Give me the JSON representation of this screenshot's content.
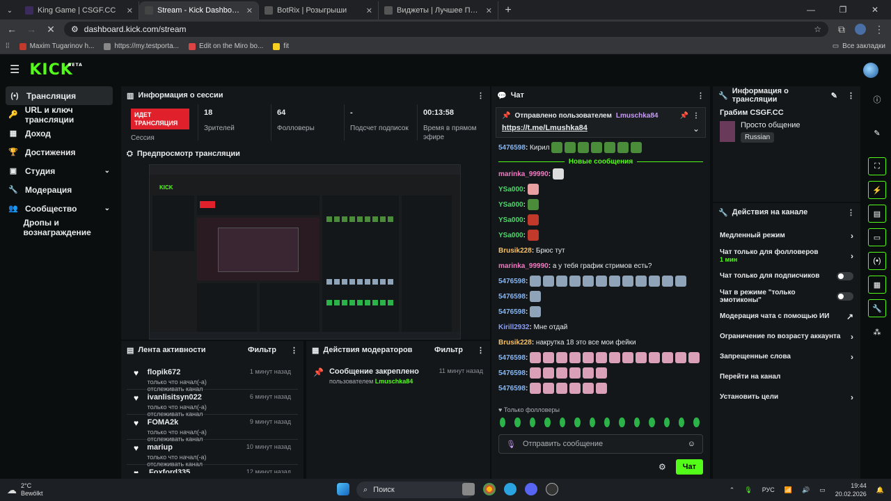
{
  "browser": {
    "tabs": [
      {
        "title": "King Game | CSGF.CC",
        "fav_color": "#3a2b5c"
      },
      {
        "title": "Stream - Kick Dashboard",
        "fav_color": "#444"
      },
      {
        "title": "BotRix | Розыгрыши",
        "fav_color": "#555"
      },
      {
        "title": "Виджеты | Лучшее ПО для улу",
        "fav_color": "#555"
      }
    ],
    "url": "dashboard.kick.com/stream",
    "bookmarks": [
      "Maxim Tugarinov h...",
      "https://my.testporta...",
      "Edit on the Miro bo...",
      "fit"
    ],
    "all_bookmarks": "Все закладки"
  },
  "app": {
    "logo": "KICK",
    "logo_badge": "BETA",
    "sidebar": [
      {
        "icon": "(•)",
        "label": "Трансляция",
        "active": true
      },
      {
        "icon": "🔑",
        "label": "URL и ключ трансляции"
      },
      {
        "icon": "▦",
        "label": "Доход"
      },
      {
        "icon": "🏆",
        "label": "Достижения"
      },
      {
        "icon": "▣",
        "label": "Студия",
        "chev": true
      },
      {
        "icon": "🔧",
        "label": "Модерация"
      },
      {
        "icon": "👥",
        "label": "Сообщество",
        "chev": true
      },
      {
        "icon": "",
        "label": "Дропы и вознаграждение"
      }
    ],
    "session": {
      "title": "Информация о сессии",
      "live_badge": "ИДЕТ ТРАНСЛЯЦИЯ",
      "cells": [
        {
          "value": "",
          "label": "Сессия"
        },
        {
          "value": "18",
          "label": "Зрителей"
        },
        {
          "value": "64",
          "label": "Фолловеры"
        },
        {
          "value": "-",
          "label": "Подсчет подписок"
        },
        {
          "value": "00:13:58",
          "label": "Время в прямом эфире"
        }
      ]
    },
    "preview": {
      "title": "Предпросмотр трансляции"
    },
    "feed": {
      "title": "Лента активности",
      "filter": "Фильтр",
      "items": [
        {
          "name": "flopik672",
          "sub": "только что начал(-а) отслеживать канал",
          "time": "1 минут назад"
        },
        {
          "name": "ivanlisitsyn022",
          "sub": "только что начал(-а) отслеживать канал",
          "time": "6 минут назад"
        },
        {
          "name": "FOMA2k",
          "sub": "только что начал(-а) отслеживать канал",
          "time": "9 минут назад"
        },
        {
          "name": "mariup",
          "sub": "только что начал(-а) отслеживать канал",
          "time": "10 минут назад"
        },
        {
          "name": "Foxford335",
          "sub": "",
          "time": "12 минут назад"
        }
      ]
    },
    "modactions": {
      "title": "Действия модераторов",
      "filter": "Фильтр",
      "item": {
        "title": "Сообщение закреплено",
        "sub_prefix": "пользователем",
        "user": "Lmuschka84",
        "time": "11 минут назад"
      }
    },
    "chat": {
      "title": "Чат",
      "pinned_by": "Отправлено пользователем",
      "pinned_user": "Lmuschka84",
      "pinned_link": "https://t.me/Lmushka84",
      "new_messages": "Новые сообщения",
      "messages": [
        {
          "user": "5476598",
          "color": "#86b8f7",
          "text": "Кирил",
          "emotes": 7,
          "emote_color": "#4a8c3a"
        },
        {
          "user": "marinka_99990",
          "color": "#f07ac2",
          "text": "",
          "emotes": 1,
          "emote_color": "#ddd"
        },
        {
          "user": "YSa000",
          "color": "#4cd96a",
          "text": "",
          "emotes": 1,
          "emote_color": "#e8a0a0"
        },
        {
          "user": "YSa000",
          "color": "#4cd96a",
          "text": "",
          "emotes": 1,
          "emote_color": "#4a8c3a"
        },
        {
          "user": "YSa000",
          "color": "#4cd96a",
          "text": "",
          "emotes": 1,
          "emote_color": "#c0392b"
        },
        {
          "user": "YSa000",
          "color": "#4cd96a",
          "text": "",
          "emotes": 1,
          "emote_color": "#c0392b"
        },
        {
          "user": "Brusik228",
          "color": "#f5c06a",
          "text": "Брюс тут",
          "emotes": 0
        },
        {
          "user": "marinka_99990",
          "color": "#f07ac2",
          "text": "а у тебя график стримов есть?",
          "emotes": 0
        },
        {
          "user": "5476598",
          "color": "#86b8f7",
          "text": "",
          "emotes": 12,
          "emote_color": "#8fa4b8"
        },
        {
          "user": "5476598",
          "color": "#86b8f7",
          "text": "",
          "emotes": 1,
          "emote_color": "#8fa4b8"
        },
        {
          "user": "5476598",
          "color": "#86b8f7",
          "text": "",
          "emotes": 1,
          "emote_color": "#8fa4b8"
        },
        {
          "user": "Kirill2932",
          "color": "#8a9ef7",
          "text": "Мне отдай",
          "emotes": 0
        },
        {
          "user": "Brusik228",
          "color": "#f5c06a",
          "text": "накрутка 18 это все мои фейки",
          "emotes": 0
        },
        {
          "user": "5476598",
          "color": "#86b8f7",
          "text": "",
          "emotes": 13,
          "emote_color": "#d9a0b8"
        },
        {
          "user": "5476598",
          "color": "#86b8f7",
          "text": "",
          "emotes": 6,
          "emote_color": "#d9a0b8"
        },
        {
          "user": "5476598",
          "color": "#86b8f7",
          "text": "",
          "emotes": 6,
          "emote_color": "#d9a0b8"
        }
      ],
      "followers_only": "Только фолловеры",
      "input_placeholder": "Отправить сообщение",
      "send_label": "Чат"
    },
    "streaminfo": {
      "title": "Информация о трансляции",
      "stream_title": "Грабим CSGF.CC",
      "category": "Просто общение",
      "language": "Russian"
    },
    "channel_actions": {
      "title": "Действия на канале",
      "rows": [
        {
          "label": "Медленный режим",
          "kind": "chev"
        },
        {
          "label": "Чат только для фолловеров",
          "sub": "1 мин",
          "kind": "chev"
        },
        {
          "label": "Чат только для подписчиков",
          "kind": "toggle"
        },
        {
          "label": "Чат в режиме \"только эмотиконы\"",
          "kind": "toggle"
        },
        {
          "label": "Модерация чата с помощью ИИ",
          "kind": "ext"
        },
        {
          "label": "Ограничение по возрасту аккаунта",
          "kind": "chev"
        },
        {
          "label": "Запрещенные слова",
          "kind": "chev"
        },
        {
          "label": "Перейти на канал",
          "kind": "none"
        },
        {
          "label": "Установить цели",
          "kind": "chev"
        }
      ]
    }
  },
  "taskbar": {
    "weather_temp": "2°C",
    "weather_desc": "Bewölkt",
    "search": "Поиск",
    "lang": "РУС",
    "time": "19:44",
    "date": "20.02.2026"
  }
}
